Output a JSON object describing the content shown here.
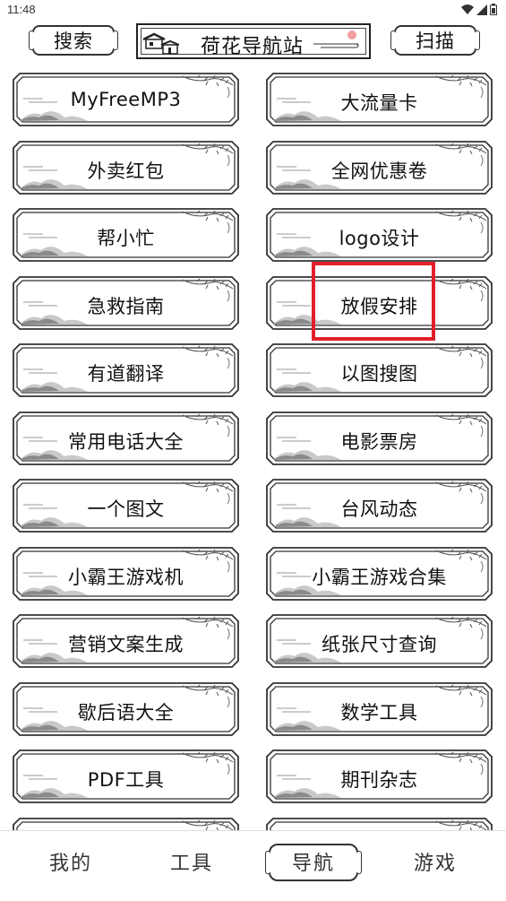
{
  "status_bar": {
    "time": "11:48",
    "icons": [
      "wifi-icon",
      "signal-icon",
      "battery-icon"
    ]
  },
  "header": {
    "search_label": "搜索",
    "title": "荷花导航站",
    "scan_label": "扫描"
  },
  "items": [
    "MyFreeMP3",
    "大流量卡",
    "外卖红包",
    "全网优惠卷",
    "帮小忙",
    "logo设计",
    "急救指南",
    "放假安排",
    "有道翻译",
    "以图搜图",
    "常用电话大全",
    "电影票房",
    "一个图文",
    "台风动态",
    "小霸王游戏机",
    "小霸王游戏合集",
    "营销文案生成",
    "纸张尺寸查询",
    "歇后语大全",
    "数学工具",
    "PDF工具",
    "期刊杂志",
    "",
    ""
  ],
  "highlighted_item": "logo设计",
  "bottom_nav": {
    "items": [
      "我的",
      "工具",
      "导航",
      "游戏"
    ],
    "active": "导航"
  },
  "colors": {
    "highlight": "#e0202a",
    "frame": "#333333"
  }
}
